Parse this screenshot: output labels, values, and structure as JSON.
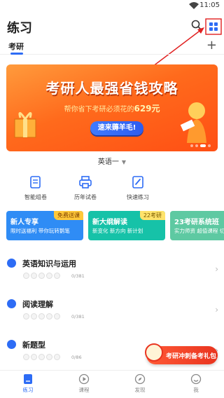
{
  "status_bar": {
    "time": "11:05"
  },
  "header": {
    "title": "练习"
  },
  "tabs": {
    "items": [
      {
        "label": "考研"
      }
    ],
    "add_label": "+"
  },
  "banner": {
    "headline": "考研人最强省钱攻略",
    "subline_prefix": "帮你省下考研必须花的",
    "subline_amount": "629元",
    "cta": "速来薅羊毛!"
  },
  "subject_selector": {
    "value": "英语一"
  },
  "tools": [
    {
      "label": "智能组卷",
      "icon": "smart-paper-icon"
    },
    {
      "label": "历年试卷",
      "icon": "printer-icon"
    },
    {
      "label": "快速练习",
      "icon": "quick-practice-icon"
    }
  ],
  "promos": [
    {
      "title": "新人专享",
      "subtitle": "限时送福利 带你玩转鹅笔",
      "badge": "免费送课",
      "color": "#2f8cf5",
      "badge_color": "#ffc83a"
    },
    {
      "title": "新大纲解读",
      "subtitle": "新变化  新方向  新计划",
      "badge": "22考研",
      "color": "#16c2a8",
      "badge_color": "#ffe36b"
    },
    {
      "title": "23考研系统班",
      "subtitle": "实力师资 超值课程 切",
      "badge": "",
      "color": "#5ec9a2",
      "badge_color": ""
    }
  ],
  "sections": [
    {
      "name": "英语知识与运用",
      "count": "0/381"
    },
    {
      "name": "阅读理解",
      "count": "0/381"
    },
    {
      "name": "新题型",
      "count": "0/86"
    }
  ],
  "floating_gift": {
    "label": "考研冲刺备考礼包"
  },
  "bottom_nav": [
    {
      "label": "练习",
      "icon": "practice-icon",
      "active": true
    },
    {
      "label": "课程",
      "icon": "course-icon",
      "active": false
    },
    {
      "label": "发现",
      "icon": "discover-icon",
      "active": false
    },
    {
      "label": "我",
      "icon": "profile-icon",
      "active": false
    }
  ],
  "colors": {
    "accent": "#2d6cf5",
    "banner": "#ff6a1c",
    "annotation": "#e02020"
  }
}
